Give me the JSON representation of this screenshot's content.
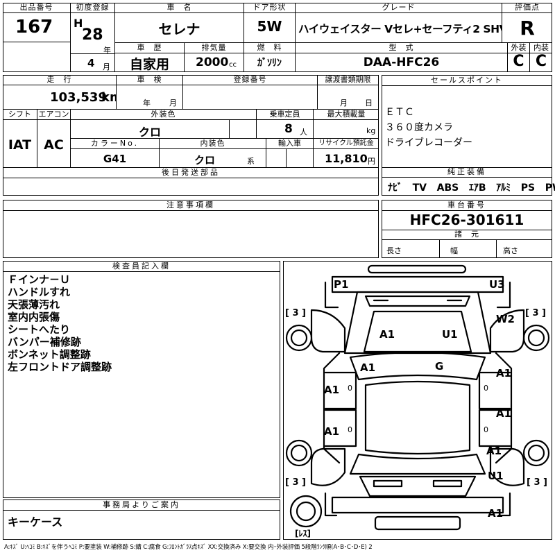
{
  "header": {
    "lot_label": "出品番号",
    "lot_value": "167",
    "first_reg_label": "初度登録",
    "era": "H",
    "year": "28",
    "year_unit": "年",
    "month": "4",
    "month_unit": "月",
    "car_label": "車　名",
    "car_value": "セレナ",
    "door_label": "ドア形状",
    "door_value": "5W",
    "grade_label": "グレード",
    "grade_value": "ハイウェイスター Vセレ+セーフティ2 SHV",
    "score_label": "評価点",
    "score_value": "R",
    "exterior_label": "外装",
    "exterior_value": "C",
    "interior_label": "内装",
    "interior_value": "C",
    "history_label": "車　歴",
    "history_value": "自家用",
    "displacement_label": "排気量",
    "displacement_value": "2000",
    "displacement_unit": "cc",
    "fuel_label": "燃　料",
    "fuel_value": "ｶﾞｿﾘﾝ",
    "model_label": "型　式",
    "model_value": "DAA-HFC26"
  },
  "row2": {
    "mileage_label": "走　行",
    "mileage_value": "103,539",
    "mileage_unit": "km",
    "inspection_label": "車　検",
    "inspection_year_unit": "年",
    "inspection_month_unit": "月",
    "regnum_label": "登録番号",
    "transfer_label": "譲渡書類期限",
    "transfer_month_unit": "月",
    "transfer_day_unit": "日",
    "shift_label": "シフト",
    "shift_value": "IAT",
    "ac_label": "エアコン",
    "ac_value": "AC",
    "color_label": "外装色",
    "color_value": "クロ",
    "capacity_label": "乗車定員",
    "capacity_value": "8",
    "capacity_unit": "人",
    "load_label": "最大積載量",
    "load_unit": "kg",
    "colorno_label": "カラーNo.",
    "colorno_value": "G41",
    "intcolor_label": "内装色",
    "intcolor_value": "クロ",
    "intcolor_unit": "系",
    "import_label": "輸入車",
    "recycle_label": "リサイクル預託金",
    "recycle_value": "11,810",
    "recycle_unit": "円",
    "later_label": "後日発送部品"
  },
  "sales": {
    "label": "セールスポイント",
    "lines": [
      "ＥＴＣ",
      "３６０度カメラ",
      "ドライブレコーダー"
    ],
    "equip_label": "純正装備",
    "equip": [
      "ﾅﾋﾞ",
      "TV",
      "ABS",
      "ｴｱB",
      "ｱﾙﾐ",
      "PS",
      "PW"
    ]
  },
  "caution": {
    "label": "注意事項欄"
  },
  "chassis": {
    "label": "車台番号",
    "value": "HFC26-301611",
    "spec_label": "諸　元",
    "length_label": "長さ",
    "width_label": "幅",
    "height_label": "高さ"
  },
  "inspector": {
    "label": "検査員記入欄",
    "lines": [
      "Ｆインナ－Ｕ",
      "ハンドルすれ",
      "天張薄汚れ",
      "室内内張傷",
      "シートへたり",
      "バンパー補修跡",
      "ボンネット調整跡",
      "左フロントドア調整跡"
    ]
  },
  "office": {
    "label": "事務局よりご案内",
    "value": "キーケース"
  },
  "legend": "A:ｷｽﾞ  U:ﾍｺﾐ  B:ｷｽﾞを伴うﾍｺﾐ  P:要塗装  W:補修跡  S:錆  C:腐食  G:ﾌﾛﾝﾄｶﾞﾗｽ点ｷｽﾞ  XX:交換済み  X:要交換  内･外装評価  5段階ﾗﾝｸ順(A･B･C･D･E) 2",
  "diagram": {
    "marks": {
      "p1": "P1",
      "u3": "U3",
      "w2": "W2",
      "a1_hood_l": "A1",
      "u1_hood_r": "U1",
      "a1_cowl": "A1",
      "g_glass": "G",
      "a1_door_fl": "A1",
      "a1_door_rl": "A1",
      "a1_door_fr": "A1",
      "a1_door_rr": "A1",
      "a1_rear_r": "A1",
      "u1_rear_r": "U1",
      "a1_bumper_r": "A1",
      "tire_fl": "[ 3 ]",
      "tire_fr": "[ 3 ]",
      "tire_rl": "[ 3 ]",
      "tire_rr": "[ 3 ]",
      "spare": "[ﾚｽ]",
      "zero_l1": "0",
      "zero_l2": "0",
      "zero_r1": "0",
      "zero_r2": "0"
    }
  }
}
